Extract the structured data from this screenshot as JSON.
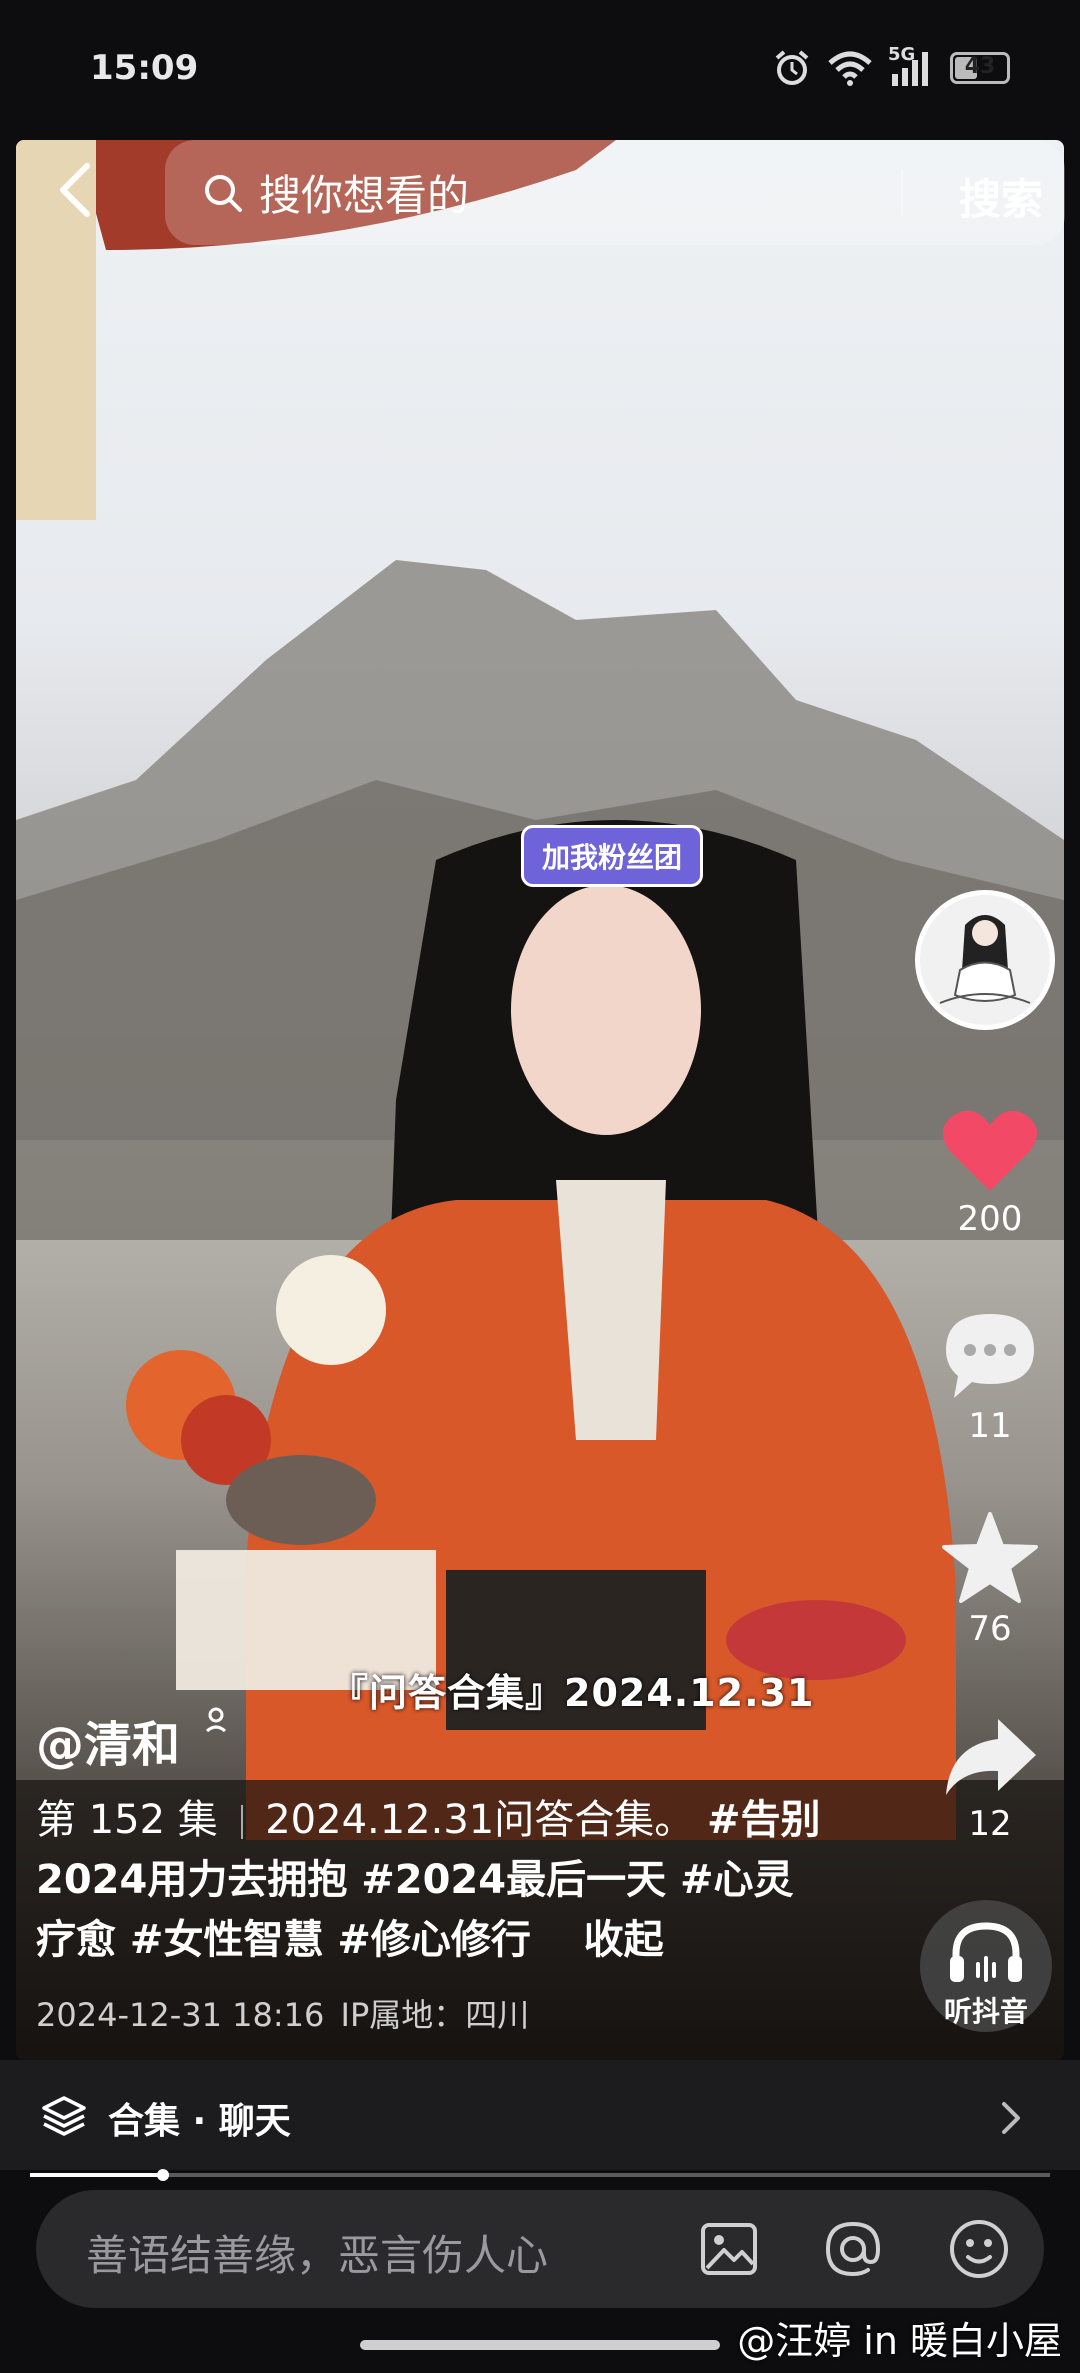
{
  "status_bar": {
    "time": "15:09",
    "network": "5G",
    "battery_level": "43"
  },
  "search": {
    "placeholder": "搜你想看的",
    "button_label": "搜索"
  },
  "video": {
    "subtitle": "『问答合集』2024.12.31",
    "sticker_text": "加我粉丝团"
  },
  "actions": {
    "likes": "200",
    "comments": "11",
    "favorites": "76",
    "shares": "12",
    "listen_label": "听抖音"
  },
  "post": {
    "author": "@清和",
    "episode": "第 152 集",
    "title": "2024.12.31问答合集。",
    "hashtags_line": "#告别2024用力去拥抱 #2024最后一天 #心灵疗愈 #女性智慧 #修心修行",
    "collapse_label": "收起",
    "datetime": "2024-12-31 18:16",
    "ip_location": "IP属地：四川"
  },
  "collection": {
    "label": "合集 · 聊天"
  },
  "playback": {
    "progress": 0.13
  },
  "comment_input": {
    "placeholder": "善语结善缘，恶言伤人心"
  },
  "watermark": "@汪婷 in 暖白小屋",
  "colors": {
    "like": "#f24a66",
    "background": "#0d0d0f"
  }
}
